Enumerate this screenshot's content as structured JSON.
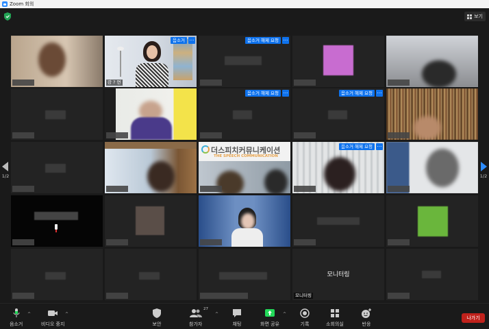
{
  "window": {
    "title": "Zoom 회의"
  },
  "topbar": {
    "view_label": "보기"
  },
  "pager": {
    "left_page": "1/2",
    "right_page": "1/2"
  },
  "colors": {
    "accent_blue": "#0e72ed",
    "active_speaker": "#b5d334",
    "leave_red": "#c0221c",
    "share_green": "#23d959"
  },
  "tiles": {
    "host_name": "강 ? 연",
    "unmute_request": "음소거 해제 요청",
    "mute_label": "음소거",
    "more": "…",
    "logo_title": "더스피치커뮤니케이션",
    "logo_subtitle": "THE SPEECH COMMUNICATION",
    "monitoring_center": "모니터링",
    "monitoring_name": "모니터링"
  },
  "toolbar": {
    "mute": "음소거",
    "video_stop": "비디오 중지",
    "security": "보안",
    "participants": "참가자",
    "participants_count": "27",
    "chat": "채팅",
    "share_screen": "화면 공유",
    "record": "기록",
    "breakout": "소회의실",
    "reactions": "반응",
    "leave": "나가기"
  }
}
